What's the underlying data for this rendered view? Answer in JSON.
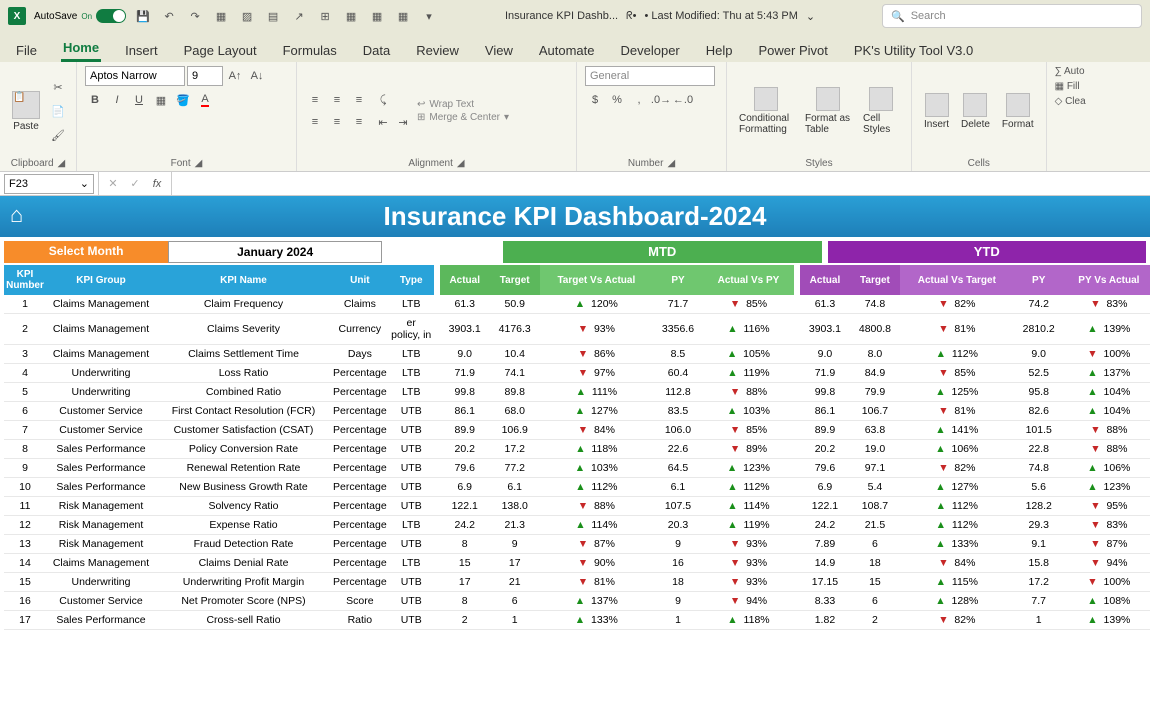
{
  "titlebar": {
    "autosave_label": "AutoSave",
    "autosave_state": "On",
    "doc_name": "Insurance KPI Dashb...",
    "modified": "• Last Modified: Thu at 5:43 PM",
    "search_placeholder": "Search"
  },
  "tabs": [
    "File",
    "Home",
    "Insert",
    "Page Layout",
    "Formulas",
    "Data",
    "Review",
    "View",
    "Automate",
    "Developer",
    "Help",
    "Power Pivot",
    "PK's Utility Tool V3.0"
  ],
  "active_tab": "Home",
  "ribbon": {
    "paste": "Paste",
    "clipboard": "Clipboard",
    "font_name": "Aptos Narrow",
    "font_size": "9",
    "font_group": "Font",
    "wrap": "Wrap Text",
    "merge": "Merge & Center",
    "alignment": "Alignment",
    "number_format": "General",
    "number": "Number",
    "cond": "Conditional Formatting",
    "fmttbl": "Format as Table",
    "cellstyle": "Cell Styles",
    "styles": "Styles",
    "insert": "Insert",
    "delete": "Delete",
    "format": "Format",
    "cells": "Cells",
    "autosum": "Auto",
    "fill": "Fill",
    "clear": "Clea"
  },
  "formula_bar": {
    "cell": "F23",
    "fx": "fx"
  },
  "dashboard": {
    "title": "Insurance KPI Dashboard-2024",
    "select_month_label": "Select Month",
    "select_month_value": "January 2024",
    "mtd_label": "MTD",
    "ytd_label": "YTD"
  },
  "columns": {
    "kpi_num": "KPI Number",
    "kpi_group": "KPI Group",
    "kpi_name": "KPI Name",
    "unit": "Unit",
    "type": "Type",
    "actual": "Actual",
    "target": "Target",
    "tva": "Target Vs Actual",
    "py": "PY",
    "avp": "Actual Vs PY",
    "avt": "Actual Vs Target",
    "pyva": "PY Vs Actual"
  },
  "rows": [
    {
      "n": 1,
      "g": "Claims Management",
      "name": "Claim Frequency",
      "unit": "Claims",
      "type": "LTB",
      "ma": "61.3",
      "mt": "50.9",
      "mtva": "120%",
      "mtvad": "up",
      "mpy": "71.7",
      "mavp": "85%",
      "mavpd": "dn",
      "ya": "61.3",
      "yt": "74.8",
      "yavt": "82%",
      "yavtd": "dn",
      "ypy": "74.2",
      "ypva": "83%",
      "ypvad": "dn"
    },
    {
      "n": 2,
      "g": "Claims Management",
      "name": "Claims Severity",
      "unit": "Currency",
      "type": "er policy, in",
      "ma": "3903.1",
      "mt": "4176.3",
      "mtva": "93%",
      "mtvad": "dn",
      "mpy": "3356.6",
      "mavp": "116%",
      "mavpd": "up",
      "ya": "3903.1",
      "yt": "4800.8",
      "yavt": "81%",
      "yavtd": "dn",
      "ypy": "2810.2",
      "ypva": "139%",
      "ypvad": "up"
    },
    {
      "n": 3,
      "g": "Claims Management",
      "name": "Claims Settlement Time",
      "unit": "Days",
      "type": "LTB",
      "ma": "9.0",
      "mt": "10.4",
      "mtva": "86%",
      "mtvad": "dn",
      "mpy": "8.5",
      "mavp": "105%",
      "mavpd": "up",
      "ya": "9.0",
      "yt": "8.0",
      "yavt": "112%",
      "yavtd": "up",
      "ypy": "9.0",
      "ypva": "100%",
      "ypvad": "dn"
    },
    {
      "n": 4,
      "g": "Underwriting",
      "name": "Loss Ratio",
      "unit": "Percentage",
      "type": "LTB",
      "ma": "71.9",
      "mt": "74.1",
      "mtva": "97%",
      "mtvad": "dn",
      "mpy": "60.4",
      "mavp": "119%",
      "mavpd": "up",
      "ya": "71.9",
      "yt": "84.9",
      "yavt": "85%",
      "yavtd": "dn",
      "ypy": "52.5",
      "ypva": "137%",
      "ypvad": "up"
    },
    {
      "n": 5,
      "g": "Underwriting",
      "name": "Combined Ratio",
      "unit": "Percentage",
      "type": "LTB",
      "ma": "99.8",
      "mt": "89.8",
      "mtva": "111%",
      "mtvad": "up",
      "mpy": "112.8",
      "mavp": "88%",
      "mavpd": "dn",
      "ya": "99.8",
      "yt": "79.9",
      "yavt": "125%",
      "yavtd": "up",
      "ypy": "95.8",
      "ypva": "104%",
      "ypvad": "up"
    },
    {
      "n": 6,
      "g": "Customer Service",
      "name": "First Contact Resolution (FCR)",
      "unit": "Percentage",
      "type": "UTB",
      "ma": "86.1",
      "mt": "68.0",
      "mtva": "127%",
      "mtvad": "up",
      "mpy": "83.5",
      "mavp": "103%",
      "mavpd": "up",
      "ya": "86.1",
      "yt": "106.7",
      "yavt": "81%",
      "yavtd": "dn",
      "ypy": "82.6",
      "ypva": "104%",
      "ypvad": "up"
    },
    {
      "n": 7,
      "g": "Customer Service",
      "name": "Customer Satisfaction (CSAT)",
      "unit": "Percentage",
      "type": "UTB",
      "ma": "89.9",
      "mt": "106.9",
      "mtva": "84%",
      "mtvad": "dn",
      "mpy": "106.0",
      "mavp": "85%",
      "mavpd": "dn",
      "ya": "89.9",
      "yt": "63.8",
      "yavt": "141%",
      "yavtd": "up",
      "ypy": "101.5",
      "ypva": "88%",
      "ypvad": "dn"
    },
    {
      "n": 8,
      "g": "Sales Performance",
      "name": "Policy Conversion Rate",
      "unit": "Percentage",
      "type": "UTB",
      "ma": "20.2",
      "mt": "17.2",
      "mtva": "118%",
      "mtvad": "up",
      "mpy": "22.6",
      "mavp": "89%",
      "mavpd": "dn",
      "ya": "20.2",
      "yt": "19.0",
      "yavt": "106%",
      "yavtd": "up",
      "ypy": "22.8",
      "ypva": "88%",
      "ypvad": "dn"
    },
    {
      "n": 9,
      "g": "Sales Performance",
      "name": "Renewal Retention Rate",
      "unit": "Percentage",
      "type": "UTB",
      "ma": "79.6",
      "mt": "77.2",
      "mtva": "103%",
      "mtvad": "up",
      "mpy": "64.5",
      "mavp": "123%",
      "mavpd": "up",
      "ya": "79.6",
      "yt": "97.1",
      "yavt": "82%",
      "yavtd": "dn",
      "ypy": "74.8",
      "ypva": "106%",
      "ypvad": "up"
    },
    {
      "n": 10,
      "g": "Sales Performance",
      "name": "New Business Growth Rate",
      "unit": "Percentage",
      "type": "UTB",
      "ma": "6.9",
      "mt": "6.1",
      "mtva": "112%",
      "mtvad": "up",
      "mpy": "6.1",
      "mavp": "112%",
      "mavpd": "up",
      "ya": "6.9",
      "yt": "5.4",
      "yavt": "127%",
      "yavtd": "up",
      "ypy": "5.6",
      "ypva": "123%",
      "ypvad": "up"
    },
    {
      "n": 11,
      "g": "Risk Management",
      "name": "Solvency Ratio",
      "unit": "Percentage",
      "type": "UTB",
      "ma": "122.1",
      "mt": "138.0",
      "mtva": "88%",
      "mtvad": "dn",
      "mpy": "107.5",
      "mavp": "114%",
      "mavpd": "up",
      "ya": "122.1",
      "yt": "108.7",
      "yavt": "112%",
      "yavtd": "up",
      "ypy": "128.2",
      "ypva": "95%",
      "ypvad": "dn"
    },
    {
      "n": 12,
      "g": "Risk Management",
      "name": "Expense Ratio",
      "unit": "Percentage",
      "type": "LTB",
      "ma": "24.2",
      "mt": "21.3",
      "mtva": "114%",
      "mtvad": "up",
      "mpy": "20.3",
      "mavp": "119%",
      "mavpd": "up",
      "ya": "24.2",
      "yt": "21.5",
      "yavt": "112%",
      "yavtd": "up",
      "ypy": "29.3",
      "ypva": "83%",
      "ypvad": "dn"
    },
    {
      "n": 13,
      "g": "Risk Management",
      "name": "Fraud Detection Rate",
      "unit": "Percentage",
      "type": "UTB",
      "ma": "8",
      "mt": "9",
      "mtva": "87%",
      "mtvad": "dn",
      "mpy": "9",
      "mavp": "93%",
      "mavpd": "dn",
      "ya": "7.89",
      "yt": "6",
      "yavt": "133%",
      "yavtd": "up",
      "ypy": "9.1",
      "ypva": "87%",
      "ypvad": "dn"
    },
    {
      "n": 14,
      "g": "Claims Management",
      "name": "Claims Denial Rate",
      "unit": "Percentage",
      "type": "LTB",
      "ma": "15",
      "mt": "17",
      "mtva": "90%",
      "mtvad": "dn",
      "mpy": "16",
      "mavp": "93%",
      "mavpd": "dn",
      "ya": "14.9",
      "yt": "18",
      "yavt": "84%",
      "yavtd": "dn",
      "ypy": "15.8",
      "ypva": "94%",
      "ypvad": "dn"
    },
    {
      "n": 15,
      "g": "Underwriting",
      "name": "Underwriting Profit Margin",
      "unit": "Percentage",
      "type": "UTB",
      "ma": "17",
      "mt": "21",
      "mtva": "81%",
      "mtvad": "dn",
      "mpy": "18",
      "mavp": "93%",
      "mavpd": "dn",
      "ya": "17.15",
      "yt": "15",
      "yavt": "115%",
      "yavtd": "up",
      "ypy": "17.2",
      "ypva": "100%",
      "ypvad": "dn"
    },
    {
      "n": 16,
      "g": "Customer Service",
      "name": "Net Promoter Score (NPS)",
      "unit": "Score",
      "type": "UTB",
      "ma": "8",
      "mt": "6",
      "mtva": "137%",
      "mtvad": "up",
      "mpy": "9",
      "mavp": "94%",
      "mavpd": "dn",
      "ya": "8.33",
      "yt": "6",
      "yavt": "128%",
      "yavtd": "up",
      "ypy": "7.7",
      "ypva": "108%",
      "ypvad": "up"
    },
    {
      "n": 17,
      "g": "Sales Performance",
      "name": "Cross-sell Ratio",
      "unit": "Ratio",
      "type": "UTB",
      "ma": "2",
      "mt": "1",
      "mtva": "133%",
      "mtvad": "up",
      "mpy": "1",
      "mavp": "118%",
      "mavpd": "up",
      "ya": "1.82",
      "yt": "2",
      "yavt": "82%",
      "yavtd": "dn",
      "ypy": "1",
      "ypva": "139%",
      "ypvad": "up"
    }
  ]
}
